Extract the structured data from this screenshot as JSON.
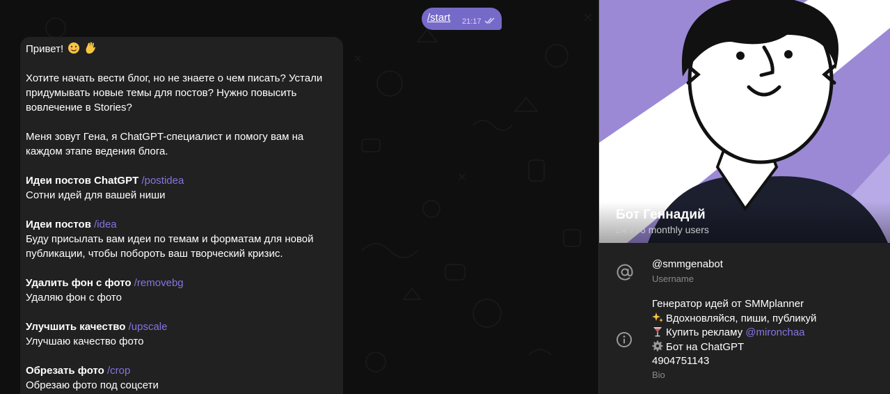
{
  "chat": {
    "sent_message": {
      "text": "/start",
      "time": "21:17"
    },
    "received_message": {
      "greeting": "Привет!",
      "intro": "Хотите начать вести блог, но не знаете о чем писать? Устали придумывать новые темы для постов? Нужно повысить вовлечение в Stories?",
      "about": "Меня зовут Гена, я ChatGPT-специалист и помогу вам на каждом этапе ведения блога.",
      "commands": [
        {
          "title": "Идеи постов ChatGPT",
          "command": "/postidea",
          "description": "Сотни идей для вашей ниши"
        },
        {
          "title": "Идеи постов",
          "command": "/idea",
          "description": "Буду присылать вам идеи по темам и форматам для новой публикации, чтобы побороть ваш творческий кризис."
        },
        {
          "title": "Удалить фон с фото",
          "command": "/removebg",
          "description": "Удаляю фон с фото"
        },
        {
          "title": "Улучшить качество",
          "command": "/upscale",
          "description": "Улучшаю качество фото"
        },
        {
          "title": "Обрезать фото",
          "command": "/crop",
          "description": "Обрезаю фото под соцсети"
        }
      ]
    }
  },
  "profile": {
    "name": "Бот Геннадий",
    "users": "24 776 monthly users",
    "username": "@smmgenabot",
    "username_caption": "Username",
    "bio": {
      "line1": "Генератор идей от SMMplanner",
      "line2": "Вдохновляйся, пиши, публикуй",
      "line3_prefix": "Купить рекламу",
      "line3_mention": "@mironchaa",
      "line4": "Бот на ChatGPT",
      "line5": "4904751143"
    },
    "bio_caption": "Bio"
  },
  "colors": {
    "accent": "#8774e1",
    "sent_bubble": "#766ac8",
    "bubble": "#212121",
    "background": "#0f0f0f",
    "avatar_purple": "#9b89d6"
  },
  "icons": [
    "read-checkmarks-icon",
    "at-sign-icon",
    "info-icon",
    "smile-emoji",
    "wave-emoji",
    "sparkles-emoji",
    "cocktail-emoji",
    "gear-emoji"
  ]
}
